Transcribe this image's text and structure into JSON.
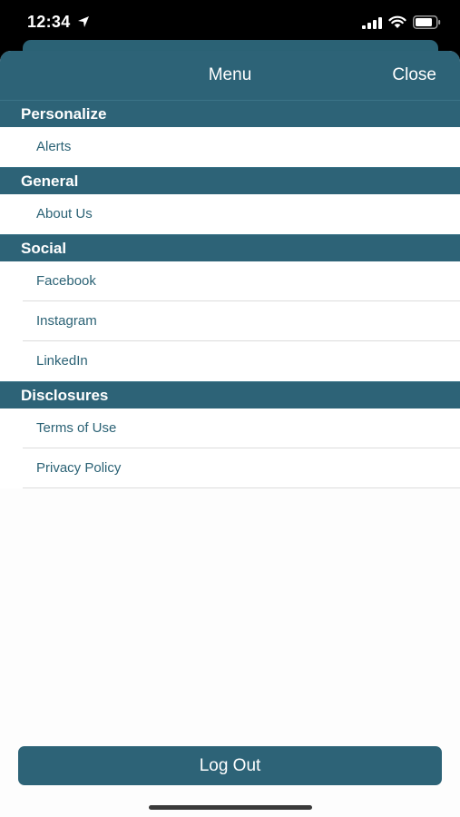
{
  "status_bar": {
    "time": "12:34"
  },
  "nav": {
    "title": "Menu",
    "close_label": "Close"
  },
  "sections": [
    {
      "header": "Personalize",
      "items": [
        "Alerts"
      ]
    },
    {
      "header": "General",
      "items": [
        "About Us"
      ]
    },
    {
      "header": "Social",
      "items": [
        "Facebook",
        "Instagram",
        "LinkedIn"
      ]
    },
    {
      "header": "Disclosures",
      "items": [
        "Terms of Use",
        "Privacy Policy"
      ]
    }
  ],
  "logout_label": "Log Out",
  "colors": {
    "primary": "#2d6377",
    "item_text": "#2b6275",
    "background": "#fdfdfd"
  }
}
